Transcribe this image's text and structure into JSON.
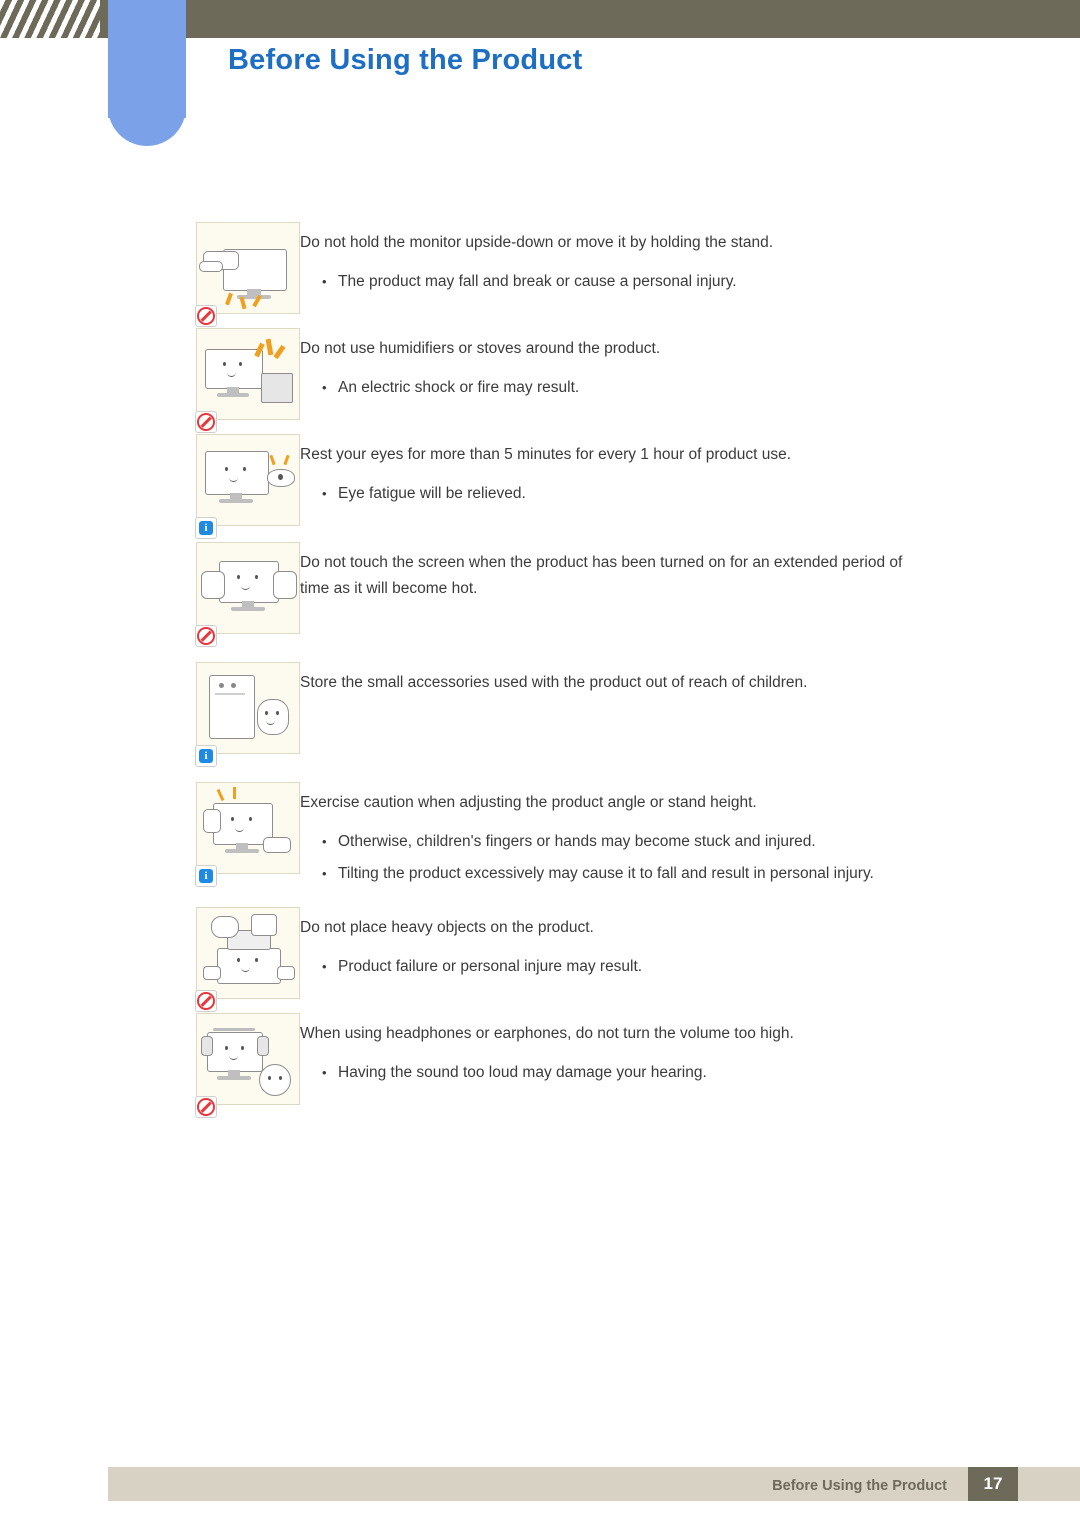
{
  "header": {
    "title": "Before Using the Product"
  },
  "footer": {
    "text": "Before Using the Product",
    "page": "17"
  },
  "main": {
    "sections": [
      {
        "icon_badge": "forbidden-icon",
        "figure": "monitor-upside-down-icon",
        "lead": "Do not hold the monitor upside-down or move it by holding the stand.",
        "bullets": [
          "The product may fall and break or cause a personal injury."
        ]
      },
      {
        "icon_badge": "forbidden-icon",
        "figure": "humidifier-stove-icon",
        "lead": "Do not use humidifiers or stoves around the product.",
        "bullets": [
          "An electric shock or fire may result."
        ]
      },
      {
        "icon_badge": "info-icon",
        "figure": "rest-eyes-icon",
        "lead": "Rest your eyes for more than 5 minutes for every 1 hour of product use.",
        "bullets": [
          "Eye fatigue will be relieved."
        ]
      },
      {
        "icon_badge": "forbidden-icon",
        "figure": "hot-screen-touch-icon",
        "lead": "Do not touch the screen when the product has been turned on for an extended period of time as it will become hot.",
        "bullets": []
      },
      {
        "icon_badge": "info-icon",
        "figure": "small-accessories-children-icon",
        "lead": "Store the small accessories used with the product out of reach of children.",
        "bullets": []
      },
      {
        "icon_badge": "info-icon",
        "figure": "adjust-angle-icon",
        "lead": "Exercise caution when adjusting the product angle or stand height.",
        "bullets": [
          "Otherwise, children's fingers or hands may become stuck and injured.",
          "Tilting the product excessively may cause it to fall and result in personal injury."
        ]
      },
      {
        "icon_badge": "forbidden-icon",
        "figure": "heavy-objects-icon",
        "lead": "Do not place heavy objects on the product.",
        "bullets": [
          "Product failure or personal injure may result."
        ]
      },
      {
        "icon_badge": "forbidden-icon",
        "figure": "headphone-volume-icon",
        "lead": "When using headphones or earphones, do not turn the volume too high.",
        "bullets": [
          "Having the sound too loud may damage your hearing."
        ]
      }
    ]
  },
  "bullet_glyph": "•"
}
